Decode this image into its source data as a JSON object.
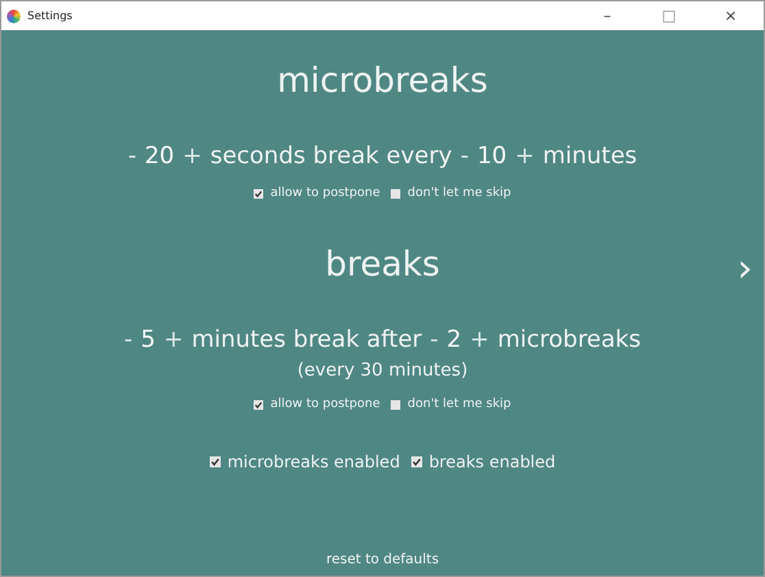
{
  "window": {
    "title": "Settings",
    "controls": [
      {
        "glyph": "–",
        "disabled": false
      },
      {
        "glyph": "□",
        "disabled": true
      },
      {
        "glyph": "×",
        "disabled": false
      }
    ]
  },
  "sections": [
    {
      "heading": "microbreaks",
      "line": [
        {
          "kind": "minus",
          "text": "-"
        },
        {
          "kind": "value",
          "text": "20"
        },
        {
          "kind": "plus",
          "text": "+"
        },
        {
          "kind": "text",
          "text": "seconds break every"
        },
        {
          "kind": "minus",
          "text": "-"
        },
        {
          "kind": "value",
          "text": "10"
        },
        {
          "kind": "plus",
          "text": "+"
        },
        {
          "kind": "text",
          "text": "minutes"
        }
      ],
      "options": [
        {
          "label": "allow to postpone",
          "checked": true
        },
        {
          "label": "don't let me skip",
          "checked": false
        }
      ]
    },
    {
      "heading": "breaks",
      "line": [
        {
          "kind": "minus",
          "text": "-"
        },
        {
          "kind": "value",
          "text": "5"
        },
        {
          "kind": "plus",
          "text": "+"
        },
        {
          "kind": "text",
          "text": "minutes break after"
        },
        {
          "kind": "minus",
          "text": "-"
        },
        {
          "kind": "value",
          "text": "2"
        },
        {
          "kind": "plus",
          "text": "+"
        },
        {
          "kind": "text",
          "text": "microbreaks"
        }
      ],
      "note": "(every 30 minutes)",
      "options": [
        {
          "label": "allow to postpone",
          "checked": true
        },
        {
          "label": "don't let me skip",
          "checked": false
        }
      ]
    }
  ],
  "toggles": [
    {
      "label": "microbreaks enabled",
      "checked": true
    },
    {
      "label": "breaks enabled",
      "checked": true
    }
  ],
  "next": "›",
  "reset": "reset to defaults"
}
